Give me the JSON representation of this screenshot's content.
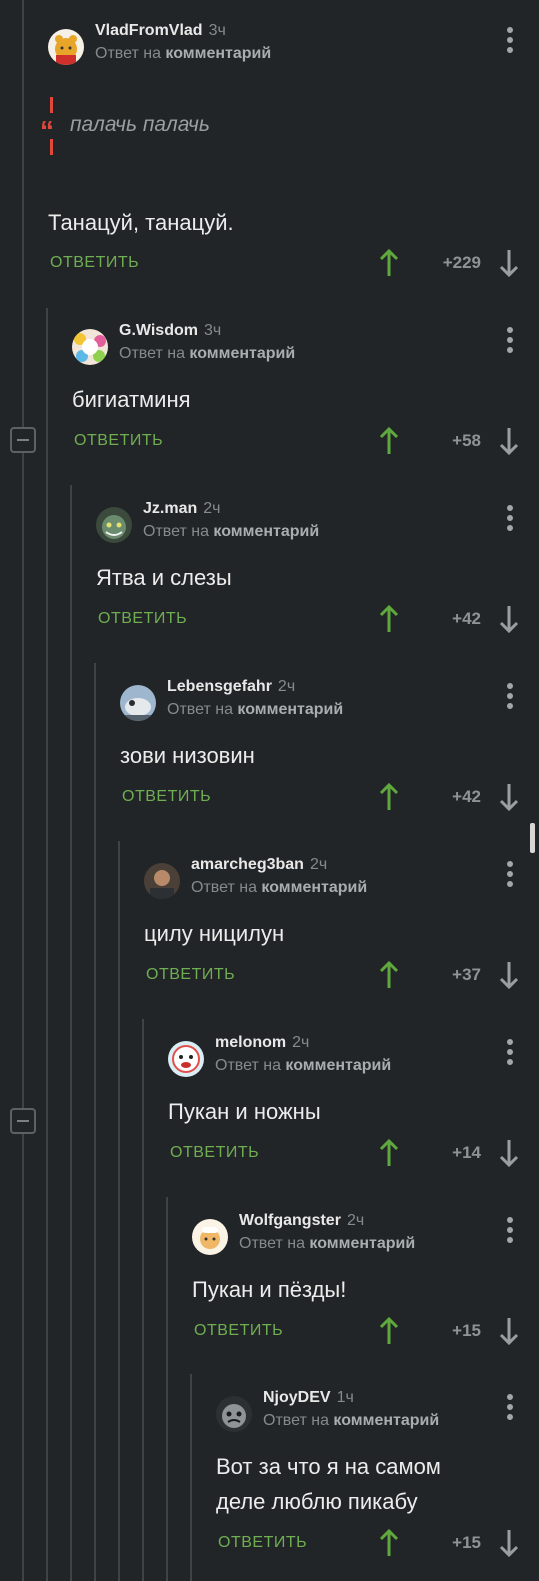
{
  "reply_label": "ОТВЕТИТЬ",
  "reply_prefix": "Ответ на",
  "reply_link": "комментарий",
  "colors": {
    "bg": "#222527",
    "accent": "#6fae52",
    "quote": "#e1473b",
    "muted": "#868a8d"
  },
  "icons": [
    "more-vert-icon",
    "arrow-up-icon",
    "arrow-down-icon",
    "quote-icon",
    "collapse-icon"
  ],
  "comments": [
    {
      "user": "VladFromVlad",
      "time": "3ч",
      "quote": "палачь палачь",
      "text": "Танацуй, танацуй.",
      "score": "+229"
    },
    {
      "user": "G.Wisdom",
      "time": "3ч",
      "text": "бигиатминя",
      "score": "+58"
    },
    {
      "user": "Jz.man",
      "time": "2ч",
      "text": "Ятва и слезы",
      "score": "+42"
    },
    {
      "user": "Lebensgefahr",
      "time": "2ч",
      "text": "зови низовин",
      "score": "+42"
    },
    {
      "user": "amarcheg3ban",
      "time": "2ч",
      "text": "цилу ницилун",
      "score": "+37"
    },
    {
      "user": "melonom",
      "time": "2ч",
      "text": "Пукан и ножны",
      "score": "+14"
    },
    {
      "user": "Wolfgangster",
      "time": "2ч",
      "text": "Пукан и пёзды!",
      "score": "+15"
    },
    {
      "user": "NjoyDEV",
      "time": "1ч",
      "text_lines": [
        "Вот за что я на самом",
        "деле люблю пикабу"
      ],
      "score": "+15"
    }
  ]
}
